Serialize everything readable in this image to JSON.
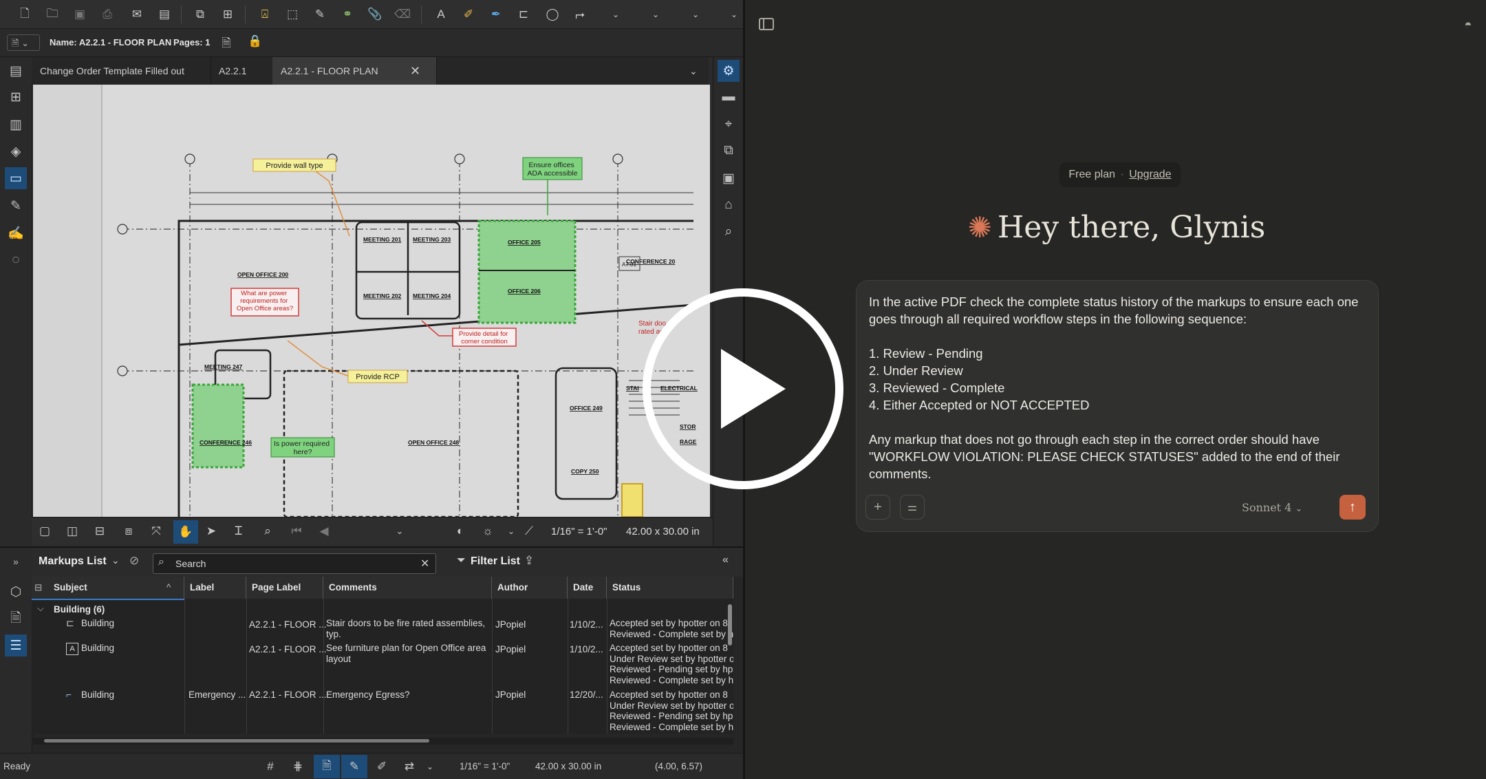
{
  "left_app": {
    "toolbar": {
      "icons": [
        "new-document-icon",
        "open-folder-icon",
        "save-icon",
        "print-icon",
        "email-icon",
        "page-layout-icon",
        "split-document-icon",
        "insert-pages-icon",
        "stamp-icon",
        "select-area-icon",
        "edit-page-icon",
        "link-icon",
        "attachment-icon",
        "erase-icon",
        "text-box-icon",
        "highlight-icon",
        "pen-icon",
        "callout-icon",
        "cloud-icon",
        "arrow-icon"
      ]
    },
    "doc_info": {
      "name_label": "Name: A2.2.1 - FLOOR PLAN",
      "pages_label": "Pages: 1"
    },
    "tabs": [
      {
        "label": "Change Order Template Filled out"
      },
      {
        "label": "A2.2.1"
      },
      {
        "label": "A2.2.1 - FLOOR PLAN"
      }
    ],
    "drawing": {
      "callouts": [
        "Provide wall type",
        "Ensure offices\nADA accessible",
        "What are power\nrequirements for\nOpen Office areas?",
        "Provide detail for\ncorner condition",
        "Provide RCP",
        "Is power required\nhere?",
        "Stair doo\nrated as"
      ],
      "room_labels": [
        "MEETING 201",
        "MEETING 203",
        "MEETING 202",
        "MEETING 204",
        "OFFICE 205",
        "OFFICE 206",
        "OPEN OFFICE 200",
        "CONFERENCE 20",
        "MEETING 247",
        "OFFICE 249",
        "CONFERENCE 246",
        "OPEN OFFICE 248",
        "COPY 250",
        "ELECTRICAL",
        "STAI",
        "STOR",
        "RAGE",
        "A7.01"
      ]
    },
    "view_toolbar": {
      "scale": "1/16\" = 1'-0\"",
      "page_size": "42.00 x 30.00 in"
    },
    "markups": {
      "title": "Markups List",
      "search_placeholder": "Search",
      "filter_label": "Filter List",
      "columns": [
        "Subject",
        "Label",
        "Page Label",
        "Comments",
        "Author",
        "Date",
        "Status"
      ],
      "group": "Building (6)",
      "rows": [
        {
          "subject": "Building",
          "label": "",
          "page_label": "A2.2.1 - FLOOR ...",
          "comments": "Stair doors to be fire rated assemblies,\ntyp.",
          "author": "JPopiel",
          "date": "1/10/2...",
          "status": "Accepted set by hpotter on 8\nReviewed - Complete set by h"
        },
        {
          "subject": "Building",
          "label": "",
          "page_label": "A2.2.1 - FLOOR ...",
          "comments": "See furniture plan for Open Office area\nlayout",
          "author": "JPopiel",
          "date": "1/10/2...",
          "status": "Accepted set by hpotter on 8\nUnder Review set by hpotter o\nReviewed - Pending set by hp\nReviewed - Complete set by h"
        },
        {
          "subject": "Building",
          "label": "Emergency ...",
          "page_label": "A2.2.1 - FLOOR ...",
          "comments": "Emergency Egress?",
          "author": "JPopiel",
          "date": "12/20/...",
          "status": "Accepted set by hpotter on 8\nUnder Review set by hpotter o\nReviewed - Pending set by hp\nReviewed - Complete set by h"
        }
      ]
    },
    "status_bar": {
      "state": "Ready",
      "scale": "1/16\" = 1'-0\"",
      "page_size": "42.00 x 30.00 in",
      "coords": "(4.00, 6.57)"
    }
  },
  "right_app": {
    "plan": {
      "label": "Free plan",
      "separator": "·",
      "upgrade": "Upgrade"
    },
    "greeting": "Hey there, Glynis",
    "prompt": "In the active PDF check the complete status history of the markups to ensure each one goes through all required workflow steps in the following sequence:\n\n1. Review - Pending\n2. Under Review\n3. Reviewed - Complete\n4. Either Accepted or NOT ACCEPTED\n\nAny markup that does not go through each step in the correct order should have \"WORKFLOW VIOLATION: PLEASE CHECK STATUSES\" added to the end of their comments.",
    "model": "Sonnet 4",
    "accent_color": "#c6613f"
  }
}
